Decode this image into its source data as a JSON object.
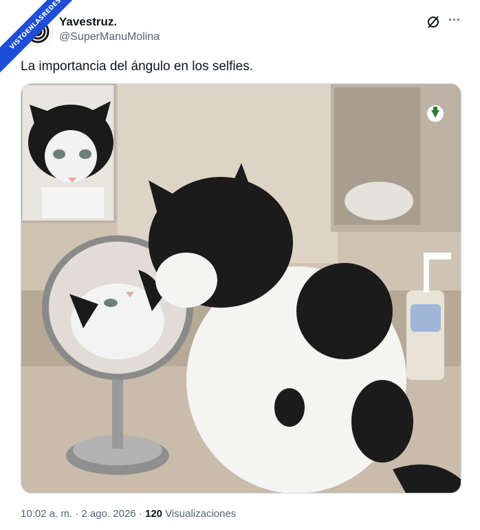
{
  "watermark": {
    "text": "VISTOENLASREDES"
  },
  "author": {
    "display_name": "Yavestruz.",
    "handle": "@SuperManuMolina"
  },
  "tweet": {
    "text": "La importancia del ángulo en los selfies."
  },
  "media": {
    "description_icon": "download-arrow-icon"
  },
  "meta": {
    "time": "10:02 a. m.",
    "separator": "·",
    "date": "2 ago. 2026",
    "views_count": "120",
    "views_label": "Visualizaciones"
  },
  "colors": {
    "accent": "#1d4ed8",
    "text_secondary": "#536471",
    "text_primary": "#0f1419",
    "download_badge": "#2e7d32"
  }
}
